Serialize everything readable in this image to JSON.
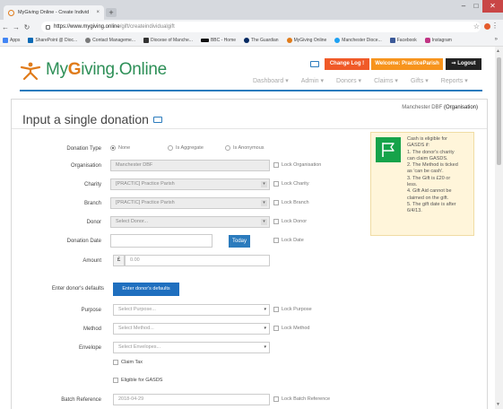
{
  "browser": {
    "tab_title": "MyGiving Online - Create Individ",
    "tab_close": "×",
    "new_tab": "+",
    "url_host": "https://www.mygiving.online",
    "url_path": "/gift/createindividualgift",
    "bookmarks": [
      "Apps",
      "SharePoint @ Dioc...",
      "Contact Manageme...",
      "Diocese of Manche...",
      "BBC - Home",
      "The Guardian",
      "MyGiving Online",
      "Manchester Dioce...",
      "Facebook",
      "Instagram"
    ],
    "bookmarks_more": "»"
  },
  "app": {
    "logo_part1": "My",
    "logo_part2": "G",
    "logo_part3": "iving.Online",
    "change_log": "Change Log !",
    "welcome": "Welcome: PracticeParish",
    "logout": "Logout",
    "nav": [
      "Dashboard",
      "Admin",
      "Donors",
      "Claims",
      "Gifts",
      "Reports"
    ]
  },
  "page": {
    "title": "Input a single donation",
    "organisation_line_prefix": "Manchester DBF ",
    "organisation_line_type": "(Organisation)"
  },
  "form": {
    "donation_type": {
      "label": "Donation Type",
      "options": [
        "None",
        "Is Aggregate",
        "Is Anonymous"
      ],
      "selected": "None"
    },
    "organisation": {
      "label": "Organisation",
      "value": "Manchester DBF",
      "lock": "Lock Organisation"
    },
    "charity": {
      "label": "Charity",
      "value": "[PRACTIC] Practice Parish",
      "lock": "Lock Charity"
    },
    "branch": {
      "label": "Branch",
      "value": "[PRACTIC] Practice Parish",
      "lock": "Lock Branch"
    },
    "donor": {
      "label": "Donor",
      "placeholder": "Select Donor...",
      "lock": "Lock Donor"
    },
    "donation_date": {
      "label": "Donation Date",
      "today": "Today",
      "lock": "Lock Date"
    },
    "amount": {
      "label": "Amount",
      "currency": "£",
      "placeholder": "0.00"
    },
    "donor_defaults": {
      "label": "Enter donor's defaults",
      "button": "Enter donor's defaults"
    },
    "purpose": {
      "label": "Purpose",
      "placeholder": "Select Purpose...",
      "lock": "Lock Purpose"
    },
    "method": {
      "label": "Method",
      "placeholder": "Select Method...",
      "lock": "Lock Method"
    },
    "envelope": {
      "label": "Envelope",
      "placeholder": "Select Envelopes..."
    },
    "claim_tax": "Claim Tax",
    "eligible_gasds": "Eligible for GASDS",
    "batch_reference": {
      "label": "Batch Reference",
      "value": "2018-04-29",
      "lock": "Lock Batch Reference"
    }
  },
  "note": {
    "lines": [
      "Cash is eligible for",
      "GASDS if:",
      "1. The donor's charity",
      "can claim GASDS.",
      "2. The Method is ticked",
      "as 'can be cash'.",
      "3. The Gift is £20 or",
      "less.",
      "4. Gift Aid cannot be",
      "claimed on the gift.",
      "5. The gift date is after",
      "6/4/13."
    ]
  },
  "colors": {
    "brand_green": "#2d8f57",
    "brand_orange": "#e07b1a",
    "change_log": "#f05a28",
    "welcome": "#f7941d",
    "primary_blue": "#2b7bbd",
    "note_flag": "#16a34a"
  }
}
